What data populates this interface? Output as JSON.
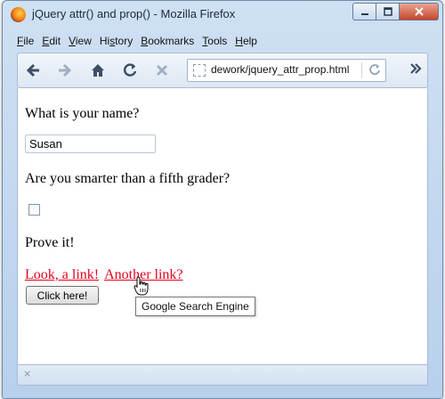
{
  "window": {
    "title": "jQuery attr() and prop() - Mozilla Firefox"
  },
  "menu": {
    "items": [
      {
        "label_u": "F",
        "label_rest": "ile"
      },
      {
        "label_u": "E",
        "label_rest": "dit"
      },
      {
        "label_u": "V",
        "label_rest": "iew"
      },
      {
        "label_u": "",
        "label_pre": "Hi",
        "label_u2": "s",
        "label_rest": "tory"
      },
      {
        "label_u": "B",
        "label_rest": "ookmarks"
      },
      {
        "label_u": "T",
        "label_rest": "ools"
      },
      {
        "label_u": "H",
        "label_rest": "elp"
      }
    ]
  },
  "toolbar": {
    "url": "dework/jquery_attr_prop.html"
  },
  "page": {
    "question_name": "What is your name?",
    "name_value": "Susan",
    "question_smarter": "Are you smarter than a fifth grader?",
    "checkbox_checked": false,
    "prove_text": "Prove it!",
    "link1": "Look, a link!",
    "link2": "Another link?",
    "button_label": "Click here!",
    "tooltip": "Google Search Engine"
  },
  "statusbar": {
    "close_glyph": "×"
  },
  "colors": {
    "link": "#e4001b",
    "accent": "#b8d0ec"
  }
}
